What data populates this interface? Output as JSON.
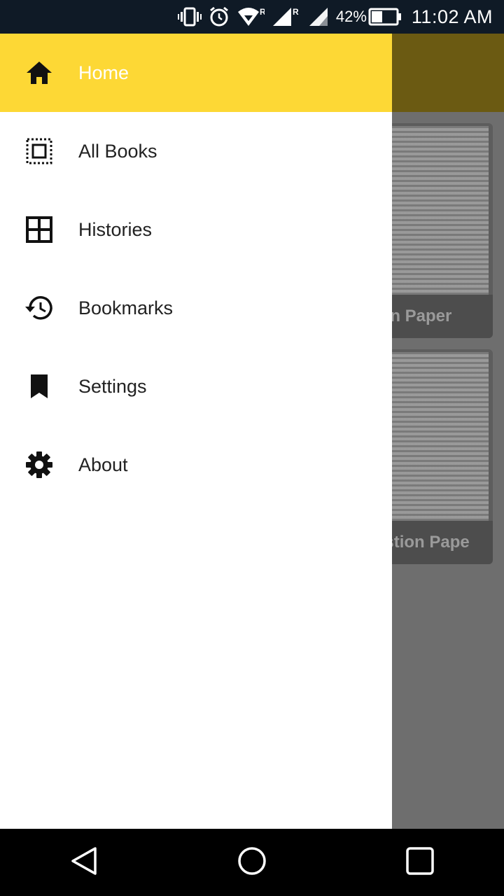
{
  "status_bar": {
    "battery_percent": "42%",
    "time": "11:02 AM",
    "icons": [
      "vibrate-icon",
      "alarm-icon",
      "wifi-icon",
      "signal-icon",
      "signal-icon",
      "battery-icon"
    ]
  },
  "drawer": {
    "items": [
      {
        "label": "Home",
        "icon": "home-icon",
        "active": true
      },
      {
        "label": "All Books",
        "icon": "books-icon",
        "active": false
      },
      {
        "label": "Histories",
        "icon": "grid-icon",
        "active": false
      },
      {
        "label": "Bookmarks",
        "icon": "history-icon",
        "active": false
      },
      {
        "label": "Settings",
        "icon": "bookmark-icon",
        "active": false
      },
      {
        "label": "About",
        "icon": "gear-icon",
        "active": false
      }
    ]
  },
  "background": {
    "cards": [
      {
        "caption": "ion Paper"
      },
      {
        "caption": "estion Pape"
      }
    ]
  },
  "nav_bar": {
    "buttons": [
      "back-button",
      "home-button",
      "recents-button"
    ]
  },
  "colors": {
    "accent": "#fdd835",
    "status_bar": "#0f1a26",
    "scrim_appbar": "#6b5a12"
  }
}
